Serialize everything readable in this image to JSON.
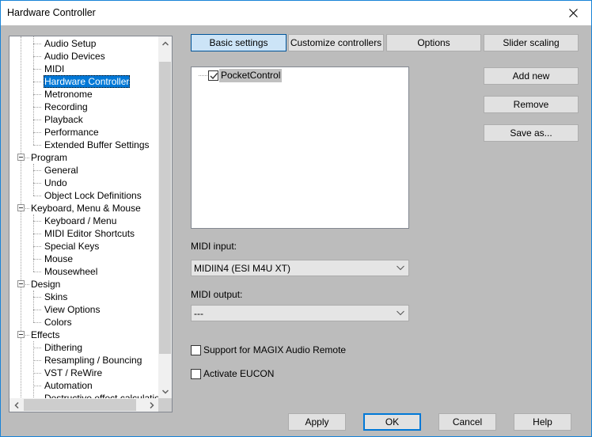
{
  "window": {
    "title": "Hardware Controller",
    "close_icon": "close-icon"
  },
  "tree": {
    "items": [
      {
        "label": "Audio Setup",
        "level": 1
      },
      {
        "label": "Audio Devices",
        "level": 1
      },
      {
        "label": "MIDI",
        "level": 1
      },
      {
        "label": "Hardware Controller",
        "level": 1,
        "selected": true
      },
      {
        "label": "Metronome",
        "level": 1
      },
      {
        "label": "Recording",
        "level": 1
      },
      {
        "label": "Playback",
        "level": 1
      },
      {
        "label": "Performance",
        "level": 1
      },
      {
        "label": "Extended Buffer Settings",
        "level": 1
      },
      {
        "label": "Program",
        "level": 0,
        "expanded": true
      },
      {
        "label": "General",
        "level": 1
      },
      {
        "label": "Undo",
        "level": 1
      },
      {
        "label": "Object Lock Definitions",
        "level": 1
      },
      {
        "label": "Keyboard, Menu & Mouse",
        "level": 0,
        "expanded": true
      },
      {
        "label": "Keyboard / Menu",
        "level": 1
      },
      {
        "label": "MIDI Editor Shortcuts",
        "level": 1
      },
      {
        "label": "Special Keys",
        "level": 1
      },
      {
        "label": "Mouse",
        "level": 1
      },
      {
        "label": "Mousewheel",
        "level": 1
      },
      {
        "label": "Design",
        "level": 0,
        "expanded": true
      },
      {
        "label": "Skins",
        "level": 1
      },
      {
        "label": "View Options",
        "level": 1
      },
      {
        "label": "Colors",
        "level": 1
      },
      {
        "label": "Effects",
        "level": 0,
        "expanded": true
      },
      {
        "label": "Dithering",
        "level": 1
      },
      {
        "label": "Resampling / Bouncing",
        "level": 1
      },
      {
        "label": "VST / ReWire",
        "level": 1
      },
      {
        "label": "Automation",
        "level": 1
      },
      {
        "label": "Destructive effect calculation",
        "level": 1
      }
    ]
  },
  "tabs": [
    {
      "label": "Basic settings",
      "active": true
    },
    {
      "label": "Customize controllers",
      "active": false
    },
    {
      "label": "Options",
      "active": false
    },
    {
      "label": "Slider scaling",
      "active": false
    }
  ],
  "controllers": [
    {
      "label": "PocketControl",
      "checked": true
    }
  ],
  "side_buttons": {
    "add_new": "Add new",
    "remove": "Remove",
    "save_as": "Save as..."
  },
  "midi_input": {
    "label": "MIDI input:",
    "value": "MIDIIN4 (ESI M4U XT)"
  },
  "midi_output": {
    "label": "MIDI output:",
    "value": "---"
  },
  "checkboxes": {
    "magix_remote": {
      "label": "Support for MAGIX Audio Remote",
      "checked": false
    },
    "eucon": {
      "label": "Activate EUCON",
      "checked": false
    }
  },
  "dialog_buttons": {
    "apply": "Apply",
    "ok": "OK",
    "cancel": "Cancel",
    "help": "Help"
  },
  "colors": {
    "accent": "#0078d7",
    "dialog_bg": "#bcbcbc",
    "active_tab_bg": "#cce4f7"
  }
}
